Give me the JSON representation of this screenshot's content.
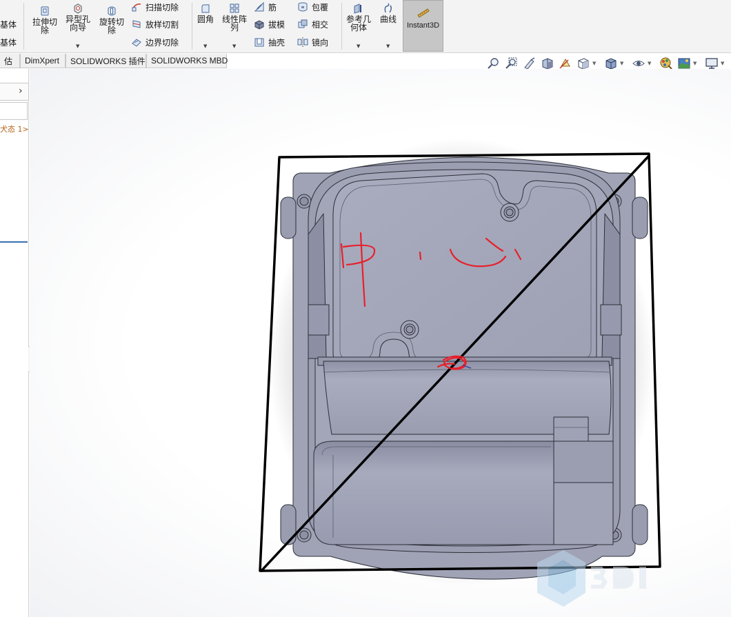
{
  "ribbon": {
    "left_cut": [
      {
        "name": "base-1",
        "label": "基体"
      },
      {
        "name": "base-2",
        "label": "基体"
      }
    ],
    "big_buttons": [
      {
        "name": "extrude-cut",
        "label": "拉伸切\n除",
        "icon": "extrude-cut-icon",
        "dropdown": false
      },
      {
        "name": "hole-wizard",
        "label": "异型孔\n向导",
        "icon": "hole-wizard-icon",
        "dropdown": true
      },
      {
        "name": "revolve-cut",
        "label": "旋转切\n除",
        "icon": "revolve-cut-icon",
        "dropdown": false
      }
    ],
    "cut_group": [
      {
        "name": "sweep-cut",
        "label": "扫描切除",
        "icon": "sweep-cut-icon"
      },
      {
        "name": "loft-cut",
        "label": "放样切割",
        "icon": "loft-cut-icon"
      },
      {
        "name": "boundary-cut",
        "label": "边界切除",
        "icon": "boundary-cut-icon"
      }
    ],
    "fillet": {
      "label": "圆角",
      "icon": "fillet-icon",
      "dropdown": true
    },
    "linear_pattern": {
      "label": "线性阵\n列",
      "icon": "linear-pattern-icon",
      "dropdown": true
    },
    "features_a": [
      {
        "name": "rib",
        "label": "筋",
        "icon": "rib-icon"
      },
      {
        "name": "draft",
        "label": "拔模",
        "icon": "draft-icon"
      },
      {
        "name": "shell",
        "label": "抽壳",
        "icon": "shell-icon"
      }
    ],
    "features_b": [
      {
        "name": "wrap",
        "label": "包覆",
        "icon": "wrap-icon"
      },
      {
        "name": "intersect",
        "label": "相交",
        "icon": "intersect-icon"
      },
      {
        "name": "mirror",
        "label": "镜向",
        "icon": "mirror-icon"
      }
    ],
    "reference_geometry": {
      "label": "参考几\n何体",
      "icon": "reference-geometry-icon",
      "dropdown": true
    },
    "curves": {
      "label": "曲线",
      "icon": "curves-icon",
      "dropdown": true
    },
    "instant3d": {
      "label": "Instant3D",
      "icon": "instant3d-icon"
    }
  },
  "tabs": [
    {
      "name": "tab-evaluate",
      "label": "估"
    },
    {
      "name": "tab-dimxpert",
      "label": "DimXpert"
    },
    {
      "name": "tab-solidworks-addins",
      "label": "SOLIDWORKS 插件"
    },
    {
      "name": "tab-solidworks-mbd",
      "label": "SOLIDWORKS MBD"
    }
  ],
  "heads_up_toolbar": [
    {
      "name": "zoom-to-fit",
      "icon": "zoom-to-fit-icon"
    },
    {
      "name": "zoom-to-area",
      "icon": "zoom-to-area-icon"
    },
    {
      "name": "previous-view",
      "icon": "previous-view-icon"
    },
    {
      "name": "section-view",
      "icon": "section-view-icon"
    },
    {
      "name": "dynamic-annotation-views",
      "icon": "dynamic-annotation-icon"
    },
    {
      "name": "view-orientation",
      "icon": "view-orientation-icon"
    },
    {
      "name": "display-style",
      "icon": "display-style-icon"
    },
    {
      "name": "hide-show-items",
      "icon": "hide-show-icon"
    },
    {
      "name": "edit-appearance",
      "icon": "appearance-icon"
    },
    {
      "name": "apply-scene",
      "icon": "scene-icon"
    },
    {
      "name": "view-settings",
      "icon": "monitor-icon"
    }
  ],
  "feature_tree": {
    "config_state": "犬态 1>"
  },
  "colors": {
    "ribbon_bg": "#f3f3f3",
    "instant3d_active": "#c6c6c6",
    "part_face": "#a3a6b8",
    "part_edge": "#2b2d38",
    "markup_black": "#000000",
    "markup_red": "#e8202a",
    "selection_blue": "#3a6fb0",
    "state_orange": "#b5651d"
  }
}
